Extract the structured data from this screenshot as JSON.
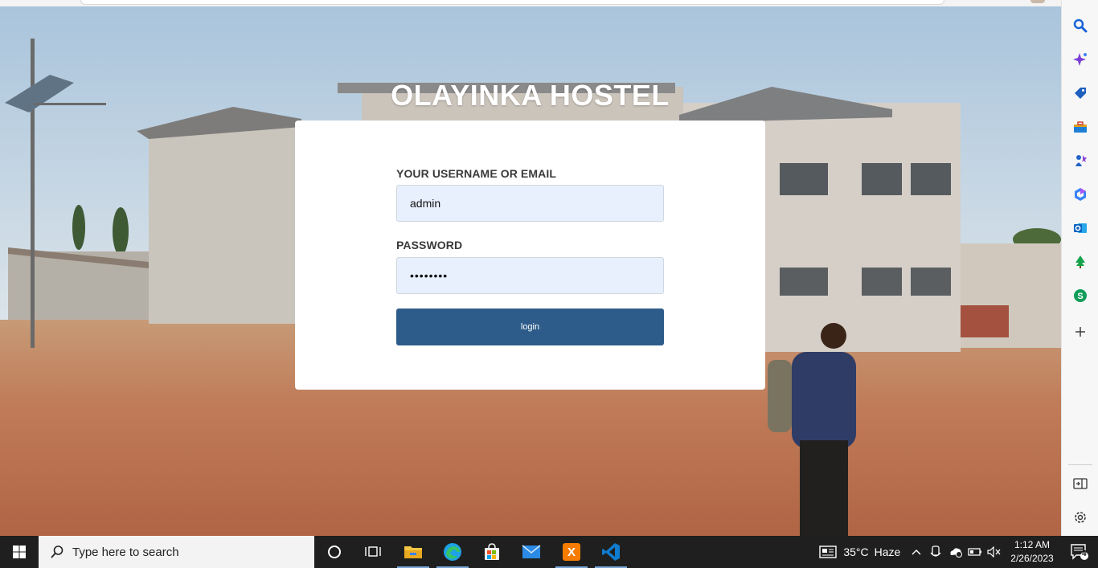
{
  "page": {
    "title": "OLAYINKA HOSTEL",
    "username_label": "YOUR USERNAME OR EMAIL",
    "username_value": "admin",
    "password_label": "PASSWORD",
    "password_value": "••••••••",
    "login_label": "login"
  },
  "sidebar": {
    "icons": [
      "search-icon",
      "copilot-icon",
      "shopping-tag-icon",
      "toolbox-icon",
      "games-icon",
      "office-icon",
      "outlook-icon",
      "tree-icon",
      "skype-icon",
      "add-icon",
      "split-screen-icon",
      "settings-icon"
    ]
  },
  "taskbar": {
    "search_placeholder": "Type here to search",
    "weather_temp": "35°C",
    "weather_condition": "Haze",
    "time": "1:12 AM",
    "date": "2/26/2023",
    "notification_count": "4",
    "apps": [
      "start-icon",
      "cortana-icon",
      "task-view-icon",
      "file-explorer-icon",
      "edge-icon",
      "store-icon",
      "mail-icon",
      "xampp-icon",
      "vscode-icon"
    ]
  }
}
